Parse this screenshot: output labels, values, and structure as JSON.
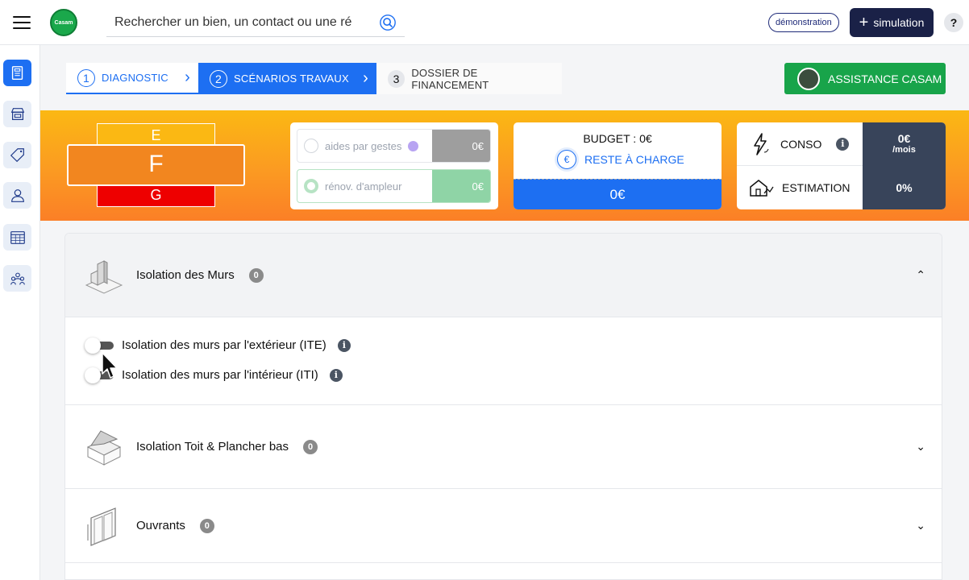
{
  "header": {
    "logo_text": "Casam",
    "search_placeholder": "Rechercher un bien, un contact ou une ré",
    "demo_label": "démonstration",
    "simulation_label": "simulation",
    "help_label": "?"
  },
  "sidebar": {
    "items": [
      "dossiers-icon",
      "store-icon",
      "tag-icon",
      "contacts-icon",
      "calendar-icon",
      "crm-icon"
    ],
    "active_index": 0
  },
  "steps": [
    {
      "num": "1",
      "label": "DIAGNOSTIC"
    },
    {
      "num": "2",
      "label": "SCÉNARIOS TRAVAUX"
    },
    {
      "num": "3",
      "label": "DOSSIER DE FINANCEMENT"
    }
  ],
  "assistance_label": "ASSISTANCE CASAM",
  "dpe": {
    "above": "E",
    "current": "F",
    "below": "G"
  },
  "aides": {
    "gestes": {
      "label": "aides par gestes",
      "value": "0€"
    },
    "ampleur": {
      "label": "rénov. d'ampleur",
      "value": "0€"
    }
  },
  "budget": {
    "title": "BUDGET : 0€",
    "reste_label": "RESTE À CHARGE",
    "reste_value": "0€",
    "euro_symbol": "€"
  },
  "conso": {
    "conso_label": "CONSO",
    "conso_value": "0€",
    "conso_unit": "/mois",
    "estimation_label": "ESTIMATION",
    "estimation_value": "0%"
  },
  "accordion": [
    {
      "title": "Isolation des Murs",
      "count": "0",
      "expanded": true,
      "chevron": "⌃",
      "options": [
        {
          "label": "Isolation des murs par l'extérieur (ITE)",
          "enabled": false
        },
        {
          "label": "Isolation des murs par l'intérieur (ITI)",
          "enabled": false
        }
      ]
    },
    {
      "title": "Isolation Toit & Plancher bas",
      "count": "0",
      "expanded": false,
      "chevron": "⌄"
    },
    {
      "title": "Ouvrants",
      "count": "0",
      "expanded": false,
      "chevron": "⌄"
    }
  ],
  "colors": {
    "primary": "#1d6ff2",
    "green": "#18a44a",
    "dark_navy": "#1a2147",
    "dpe_e": "#fbb813",
    "dpe_f": "#f2861f",
    "dpe_g": "#ee0000",
    "conso_dark": "#38445a"
  }
}
